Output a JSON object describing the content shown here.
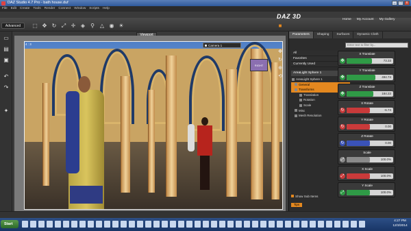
{
  "window": {
    "title": "DAZ Studio 4.7 Pro - bath house.duf",
    "buttons": [
      "_",
      "□",
      "x"
    ]
  },
  "menu": [
    "File",
    "Edit",
    "Create",
    "Tools",
    "Render",
    "Connect",
    "Window",
    "Scripts",
    "Help"
  ],
  "brand": {
    "logo": "DAZ 3D",
    "links": [
      "Home",
      "My Account",
      "My Gallery"
    ]
  },
  "mode": {
    "label": "Advanced"
  },
  "toolbar": {
    "icons": [
      "select-icon",
      "move-icon",
      "rotate-icon",
      "scale-icon",
      "universal-icon",
      "node-icon",
      "joint-icon",
      "geometry-icon",
      "camera-icon",
      "light-icon",
      "render-icon"
    ]
  },
  "left_tools": [
    "new-icon",
    "open-icon",
    "save-icon",
    "undo-icon",
    "redo-icon",
    "render-icon"
  ],
  "viewport": {
    "tab": "Viewport",
    "corner_label": "4 : 3",
    "camera": "Camera 1",
    "cube_label": "RIGHT"
  },
  "panel": {
    "tabs": [
      "Parameters",
      "Shaping",
      "Surfaces",
      "Dynamic Cloth"
    ],
    "filter_placeholder": "Enter text to filter by...",
    "categories": [
      "All",
      "Favorites",
      "Currently Used"
    ],
    "node": "AreaLight Sphere 1",
    "tree": [
      {
        "label": "AreaLight Sphere 1",
        "level": 0,
        "selected": false
      },
      {
        "label": "General",
        "level": 1,
        "selected": true
      },
      {
        "label": "Transforms",
        "level": 1,
        "selected": true
      },
      {
        "label": "Translation",
        "level": 2,
        "selected": false
      },
      {
        "label": "Rotation",
        "level": 2,
        "selected": false
      },
      {
        "label": "Scale",
        "level": 2,
        "selected": false
      },
      {
        "label": "Misc",
        "level": 1,
        "selected": false
      },
      {
        "label": "Mesh Resolution",
        "level": 1,
        "selected": false
      }
    ],
    "properties": [
      {
        "name": "X Translate",
        "value": "73.33",
        "color": "#2f9a46",
        "fill": 0.55
      },
      {
        "name": "Y Translate",
        "value": "494.74",
        "color": "#2f9a46",
        "fill": 0.62
      },
      {
        "name": "Z Translate",
        "value": "184.22",
        "color": "#2f9a46",
        "fill": 0.58
      },
      {
        "name": "X Rotate",
        "value": "-6.74",
        "color": "#c93a3a",
        "fill": 0.5
      },
      {
        "name": "Y Rotate",
        "value": "0.00",
        "color": "#c93a3a",
        "fill": 0.5
      },
      {
        "name": "Z Rotate",
        "value": "0.00",
        "color": "#3a52b8",
        "fill": 0.5
      },
      {
        "name": "Scale",
        "value": "100.0%",
        "color": "#8a8a8a",
        "fill": 0.5
      },
      {
        "name": "X Scale",
        "value": "100.0%",
        "color": "#c93a3a",
        "fill": 0.5
      },
      {
        "name": "Y Scale",
        "value": "100.0%",
        "color": "#2f9a46",
        "fill": 0.5
      }
    ],
    "show_sub_items": "Show Sub Items",
    "tips": "Tips"
  },
  "taskbar": {
    "start": "Start",
    "time": "4:27 PM",
    "date": "12/3/2014"
  }
}
